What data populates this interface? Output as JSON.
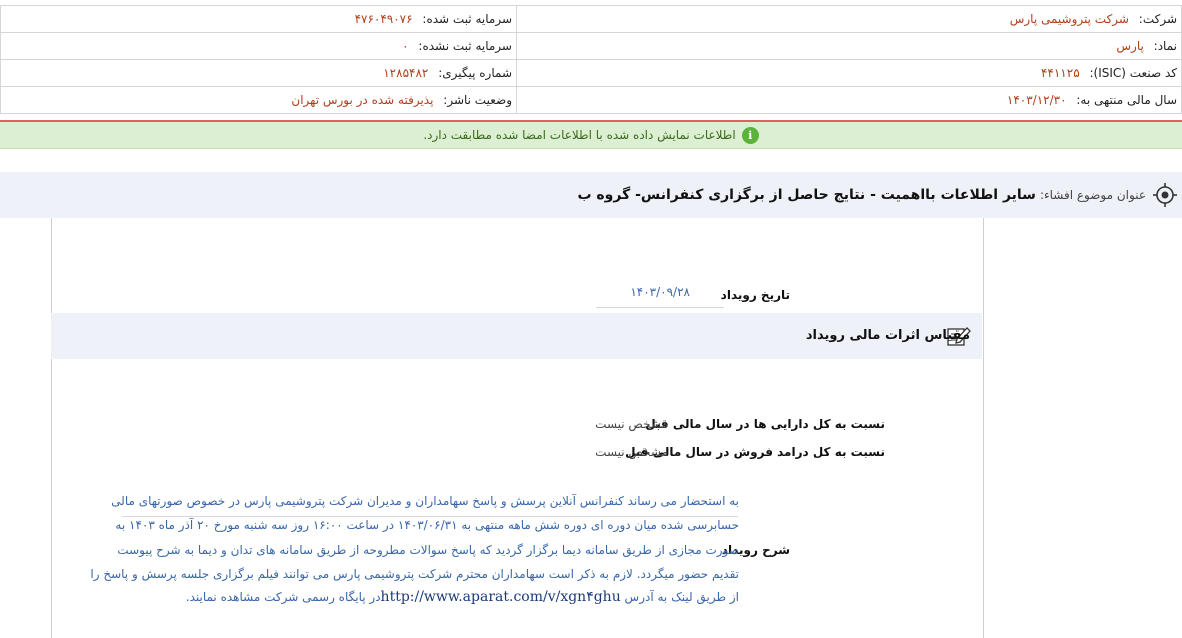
{
  "company_info": {
    "rows": [
      {
        "right_label": "شرکت:",
        "right_value": "شرکت پتروشیمی پارس",
        "left_label": "سرمایه ثبت شده:",
        "left_value": "۴۷۶۰۴۹۰۷۶"
      },
      {
        "right_label": "نماد:",
        "right_value": "پارس",
        "left_label": "سرمایه ثبت نشده:",
        "left_value": "۰"
      },
      {
        "right_label": "کد صنعت (ISIC):",
        "right_value": "۴۴۱۱۲۵",
        "left_label": "شماره پیگیری:",
        "left_value": "۱۲۸۵۴۸۲"
      },
      {
        "right_label": "سال مالی منتهی به:",
        "right_value": "۱۴۰۳/۱۲/۳۰",
        "left_label": "وضعیت ناشر:",
        "left_value": "پذیرفته شده در بورس تهران"
      }
    ]
  },
  "notice": {
    "text": "اطلاعات نمایش داده شده با اطلاعات امضا شده مطابقت دارد.",
    "icon": "info-icon",
    "color": "#5bb33b"
  },
  "subject": {
    "label": "عنوان موضوع افشاء:",
    "title": "سایر اطلاعات بااهمیت - نتایج حاصل از برگزاری کنفرانس- گروه ب"
  },
  "event": {
    "date_label": "تاریخ رویداد",
    "date_value": "۱۴۰۳/۰۹/۲۸",
    "section_title": "مقیاس اثرات مالی رویداد",
    "ratio_assets_label": "نسبت به کل دارایی ها در سال مالی قبل",
    "ratio_assets_value": "مشخص نیست",
    "ratio_revenue_label": "نسبت به کل درامد فروش در سال مالی قبل",
    "ratio_revenue_value": "مشخص نیست",
    "desc_label": "شرح رویداد",
    "desc_lines": [
      "به استحضار می رساند کنفرانس آنلاین پرسش و پاسخ سهامداران و مدیران شرکت پتروشیمی پارس در خصوص صورتهای مالی",
      "حسابرسی شده میان دوره ای دوره شش ماهه منتهی به ۱۴۰۳/۰۶/۳۱ در ساعت ۱۶:۰۰ روز سه شنبه مورخ ۲۰ آذر ماه ۱۴۰۳ به",
      "صورت مجازی از طریق سامانه دیما برگزار گردید که پاسخ سوالات مطروحه از طریق سامانه های تدان و دیما به شرح پیوست",
      "تقدیم حضور میگردد. لازم به ذکر است سهامداران محترم شرکت پتروشیمی پارس می توانند فیلم برگزاری جلسه پرسش و پاسخ را",
      "از طریق لینک به آدرس"
    ],
    "desc_link": "http://www.aparat.com/v/xgn۴ghu",
    "desc_tail": "در پایگاه رسمی شرکت مشاهده نمایند."
  }
}
